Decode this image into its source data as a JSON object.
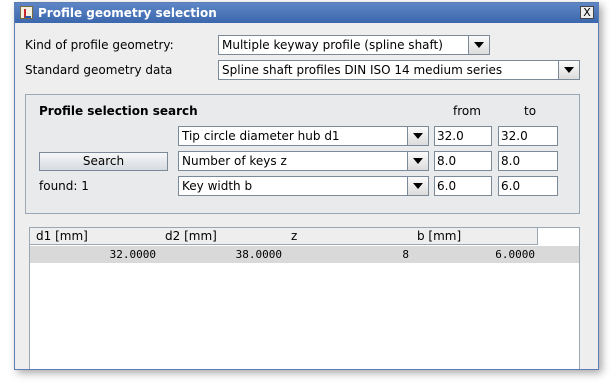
{
  "window": {
    "title": "Profile geometry selection",
    "close_glyph": "X"
  },
  "fields": {
    "kind_label": "Kind of profile geometry:",
    "kind_value": "Multiple keyway profile (spline shaft)",
    "standard_label": "Standard geometry data",
    "standard_value": "Spline shaft profiles DIN ISO 14 medium series"
  },
  "search": {
    "title": "Profile selection search",
    "from_label": "from",
    "to_label": "to",
    "button_label": "Search",
    "found_label": "found: 1",
    "rows": [
      {
        "criterion": "Tip circle diameter hub d1",
        "from": "32.0",
        "to": "32.0"
      },
      {
        "criterion": "Number of keys z",
        "from": "8.0",
        "to": "8.0"
      },
      {
        "criterion": "Key width b",
        "from": "6.0",
        "to": "6.0"
      }
    ]
  },
  "table": {
    "columns": [
      "d1 [mm]",
      "d2 [mm]",
      "z",
      "b [mm]"
    ],
    "rows": [
      [
        "32.0000",
        "38.0000",
        "8",
        "6.0000"
      ]
    ]
  }
}
